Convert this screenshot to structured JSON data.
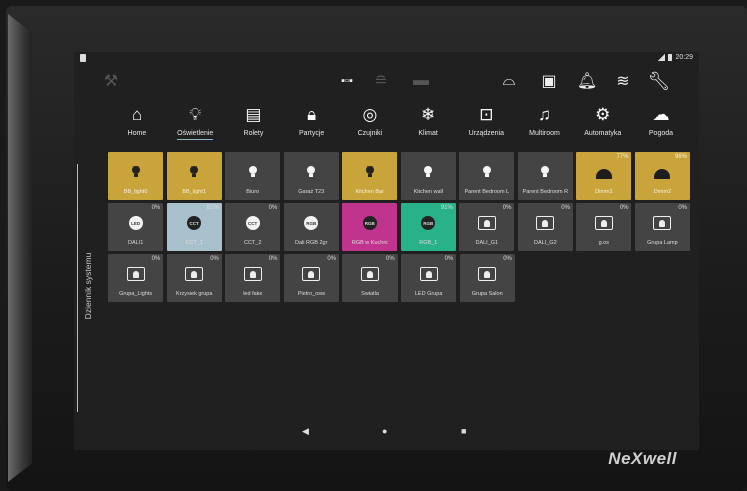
{
  "device": {
    "brand": "NeXwell"
  },
  "status": {
    "time": "20:29"
  },
  "toolbar": {
    "left_icon": "tools-icon",
    "center_icons": [
      "scene-icon",
      "hvac-icon",
      "screen-icon"
    ],
    "right_icons": [
      "camera-icon",
      "lock-icon",
      "bell-icon",
      "wifi-icon",
      "wrench-icon"
    ]
  },
  "nav": {
    "items": [
      {
        "label": "Home",
        "icon": "house-icon"
      },
      {
        "label": "Oświetlenie",
        "icon": "bulb-icon",
        "active": true
      },
      {
        "label": "Rolety",
        "icon": "blinds-icon"
      },
      {
        "label": "Partycje",
        "icon": "padlock-icon"
      },
      {
        "label": "Czujniki",
        "icon": "sensor-icon"
      },
      {
        "label": "Klimat",
        "icon": "climate-icon"
      },
      {
        "label": "Urządzenia",
        "icon": "socket-icon"
      },
      {
        "label": "Multiroom",
        "icon": "music-icon"
      },
      {
        "label": "Automatyka",
        "icon": "gear-icon"
      },
      {
        "label": "Pogoda",
        "icon": "weather-icon"
      }
    ]
  },
  "sidebar": {
    "label": "Dziennik systemu"
  },
  "tiles": {
    "row1": [
      {
        "label": "BB_light0",
        "style": "gold",
        "icon": "bulb-on",
        "pct": ""
      },
      {
        "label": "BB_light1",
        "style": "gold",
        "icon": "bulb-on",
        "pct": ""
      },
      {
        "label": "Biuro",
        "style": "grey",
        "icon": "bulb",
        "pct": ""
      },
      {
        "label": "Garaż T23",
        "style": "grey",
        "icon": "bulb",
        "pct": ""
      },
      {
        "label": "Kitchen Bar",
        "style": "gold",
        "icon": "bulb-on",
        "pct": ""
      },
      {
        "label": "Kitchen wall",
        "style": "grey",
        "icon": "bulb",
        "pct": ""
      },
      {
        "label": "Parent Bedroom L",
        "style": "grey",
        "icon": "bulb",
        "pct": ""
      },
      {
        "label": "Parent Bedroom R",
        "style": "grey",
        "icon": "bulb",
        "pct": ""
      },
      {
        "label": "Dimm1",
        "style": "gold",
        "icon": "dimmer",
        "pct": "77%"
      },
      {
        "label": "Dimm2",
        "style": "gold",
        "icon": "dimmer",
        "pct": "96%"
      }
    ],
    "row2": [
      {
        "label": "DALI1",
        "style": "grey",
        "icon": "LED",
        "pct": "0%"
      },
      {
        "label": "CCT_1",
        "style": "lightblue",
        "icon": "CCT-on",
        "pct": "81%"
      },
      {
        "label": "CCT_2",
        "style": "grey",
        "icon": "CCT",
        "pct": "0%"
      },
      {
        "label": "Dali RGB 2gr",
        "style": "grey",
        "icon": "RGB",
        "pct": ""
      },
      {
        "label": "RGB w Kuchni",
        "style": "pink",
        "icon": "RGB-on",
        "pct": ""
      },
      {
        "label": "RGB_1",
        "style": "teal",
        "icon": "RGB-on",
        "pct": "91%"
      },
      {
        "label": "DALI_G1",
        "style": "grey",
        "icon": "group",
        "pct": "0%"
      },
      {
        "label": "DALI_G2",
        "style": "grey",
        "icon": "group",
        "pct": "0%"
      },
      {
        "label": "g.os",
        "style": "grey",
        "icon": "group",
        "pct": "0%"
      },
      {
        "label": "Grupa Lamp",
        "style": "grey",
        "icon": "group",
        "pct": "0%"
      }
    ],
    "row3": [
      {
        "label": "Grupa_Lights",
        "style": "grey",
        "icon": "group",
        "pct": "0%"
      },
      {
        "label": "Krzysiek grupa",
        "style": "grey",
        "icon": "group",
        "pct": "0%"
      },
      {
        "label": "led fake",
        "style": "grey",
        "icon": "group",
        "pct": "0%"
      },
      {
        "label": "Pietro_osw",
        "style": "grey",
        "icon": "group",
        "pct": "0%"
      },
      {
        "label": "Swiatla",
        "style": "grey",
        "icon": "group",
        "pct": "0%"
      },
      {
        "label": "LED Grupa",
        "style": "grey",
        "icon": "group",
        "pct": "0%"
      },
      {
        "label": "Grupa Salon",
        "style": "grey",
        "icon": "group",
        "pct": "0%"
      }
    ]
  },
  "colors": {
    "gold": "#c9a43a",
    "pink": "#c0348d",
    "teal": "#29b28a",
    "lightblue": "#a8c0cc",
    "grey": "#444444"
  }
}
